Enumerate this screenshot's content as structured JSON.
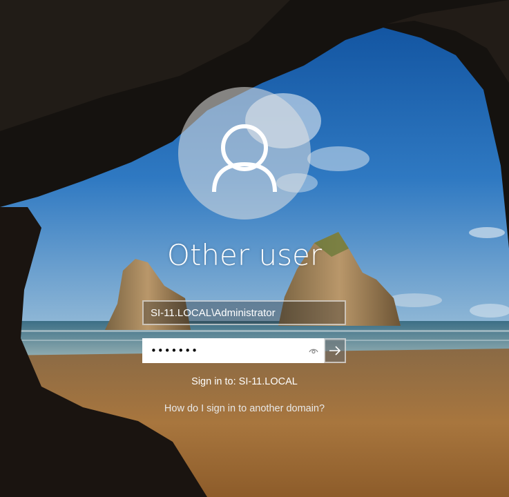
{
  "login": {
    "user_display_name": "Other user",
    "username_value": "SI-11.LOCAL\\Administrator",
    "password_value": "•••••••",
    "sign_in_to": "Sign in to: SI-11.LOCAL",
    "domain_help_link": "How do I sign in to another domain?"
  },
  "icons": {
    "avatar": "user-icon",
    "reveal": "eye-icon",
    "submit": "arrow-right-icon"
  },
  "colors": {
    "avatar_circle": "#e1e1e1",
    "password_background": "#ffffff",
    "submit_background": "#6e6e6e"
  }
}
